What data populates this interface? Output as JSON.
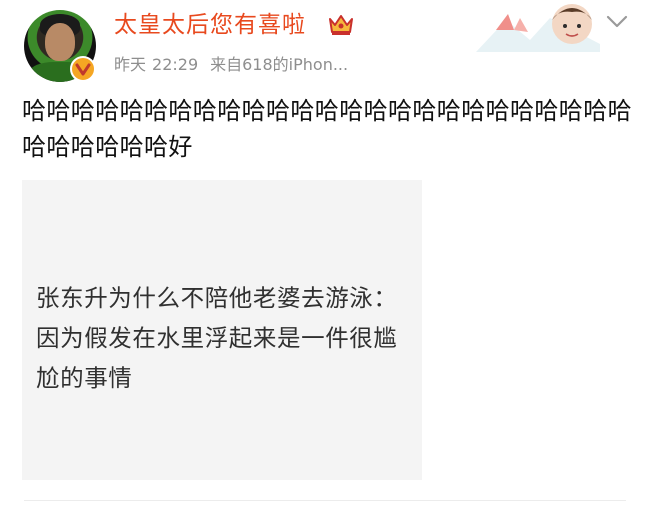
{
  "post": {
    "username": "太皇太后您有喜啦",
    "time_label": "昨天",
    "time": "22:29",
    "source": "来自618的iPhon...",
    "text": "哈哈哈哈哈哈哈哈哈哈哈哈哈哈哈哈哈哈哈哈哈哈哈哈哈哈哈哈哈哈哈好",
    "image_text": "张东升为什么不陪他老婆去游泳：因为假发在水里浮起来是一件很尴尬的事情"
  },
  "icons": {
    "crown": "crown-icon",
    "verified": "verified-badge-icon",
    "menu": "chevron-down-icon"
  },
  "colors": {
    "username": "#e8491e",
    "meta": "#8e8e8e",
    "verified_badge": "#f5a623",
    "image_background": "#f4f4f4"
  }
}
